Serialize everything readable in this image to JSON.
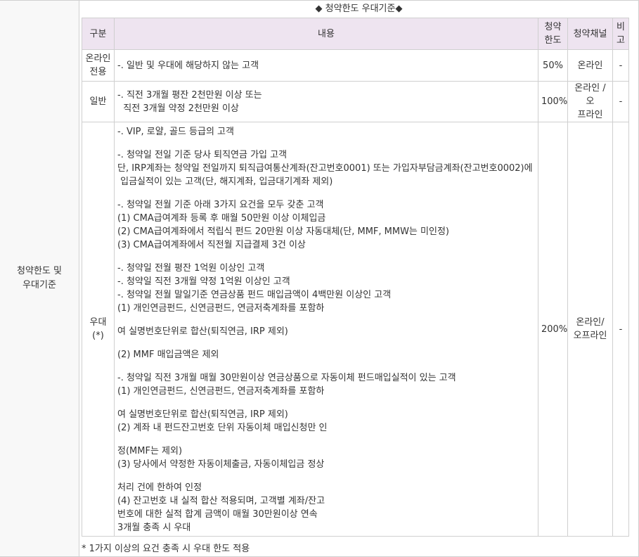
{
  "left_label_lines": [
    "청약한도 및",
    "우대기준"
  ],
  "section_title": "◆ 청약한도 우대기준◆",
  "headers": {
    "category": "구분",
    "content": "내용",
    "limit_lines": [
      "청약",
      "한도"
    ],
    "channel": "청약채널",
    "note_lines": [
      "비",
      "고"
    ]
  },
  "rows": [
    {
      "category_lines": [
        "온라인",
        "전용"
      ],
      "content_lines": [
        "-. 일반 및 우대에 해당하지 않는 고객"
      ],
      "limit": "50%",
      "channel_lines": [
        "온라인"
      ],
      "note": "-"
    },
    {
      "category_lines": [
        "일반"
      ],
      "content_lines": [
        "-. 직전 3개월 평잔 2천만원 이상 또는",
        "  직전 3개월 약정 2천만원 이상"
      ],
      "limit": "100%",
      "channel_lines": [
        "온라인 /오",
        "프라인"
      ],
      "note": "-"
    }
  ],
  "preferred": {
    "category": "우대(*)",
    "limit": "200%",
    "channel_lines": [
      "온라인/",
      "오프라인"
    ],
    "note": "-",
    "blocks": [
      [
        "-. VIP, 로얄, 골드 등급의 고객"
      ],
      [
        "-. 청약일 전일 기준 당사 퇴직연금 가입 고객",
        "단, IRP계좌는 청약일 전일까지 퇴직급여통산계좌(잔고번호0001) 또는 가입자부담금계좌(잔고번호0002)에",
        " 입금실적이 있는 고객(단, 해지계좌, 입금대기계좌 제외)"
      ],
      [
        "-. 청약일 전월 기준 아래 3가지 요건을 모두 갖춘 고객",
        "(1) CMA급여계좌 등록 후 매월 50만원 이상 이체입금",
        "(2) CMA급여계좌에서 적립식 펀드 20만원 이상 자동대체(단, MMF, MMW는 미인정)",
        "(3) CMA급여계좌에서 직전월 지급결제 3건 이상"
      ],
      [
        "-. 청약일 전월 평잔 1억원 이상인 고객",
        "-. 청약일 직전 3개월 약정 1억원 이상인 고객",
        "-. 청약일 전월 말일기준 연금상품 펀드 매입금액이 4백만원 이상인 고객",
        "(1) 개인연금펀드, 신연금펀드, 연금저축계좌를 포함하"
      ],
      [
        "여 실명번호단위로 합산(퇴직연금, IRP 제외)"
      ],
      [
        "(2) MMF 매입금액은 제외"
      ],
      [
        "-. 청약일 직전 3개월 매월 30만원이상 연금상품으로 자동이체 펀드매입실적이 있는 고객",
        "(1) 개인연금펀드, 신연금펀드, 연금저축계좌를 포함하"
      ],
      [
        "여 실명번호단위로 합산(퇴직연금, IRP 제외)",
        "(2) 계좌 내 펀드잔고번호 단위 자동이체 매입신청만 인"
      ],
      [
        "정(MMF는 제외)",
        "(3) 당사에서 약정한 자동이체출금, 자동이체입금 정상"
      ],
      [
        "처리 건에 한하여 인정",
        "(4) 잔고번호 내 실적 합산 적용되며, 고객별 계좌/잔고",
        "번호에 대한 실적 합계 금액이 매월 30만원이상 연속",
        "3개월 충족 시 우대"
      ]
    ]
  },
  "footnote": "* 1가지 이상의 요건 충족 시 우대 한도 적용"
}
